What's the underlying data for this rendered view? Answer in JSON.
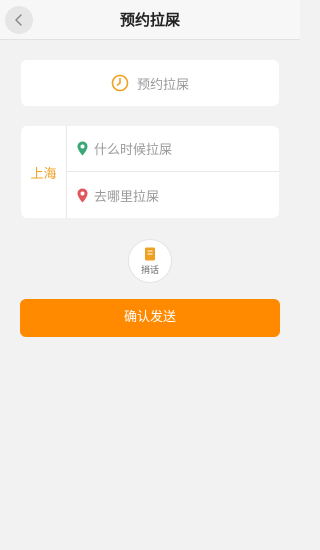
{
  "header": {
    "title": "预约拉屎"
  },
  "time": {
    "label": "预约拉屎"
  },
  "address": {
    "city": "上海",
    "when_placeholder": "什么时候拉屎",
    "where_placeholder": "去哪里拉屎"
  },
  "voice": {
    "label": "捎话"
  },
  "confirm": {
    "label": "确认发送"
  },
  "colors": {
    "accent_orange": "#ff8a00",
    "city_orange": "#f0a020",
    "pin_green": "#3aa876",
    "pin_red": "#e0565b"
  }
}
